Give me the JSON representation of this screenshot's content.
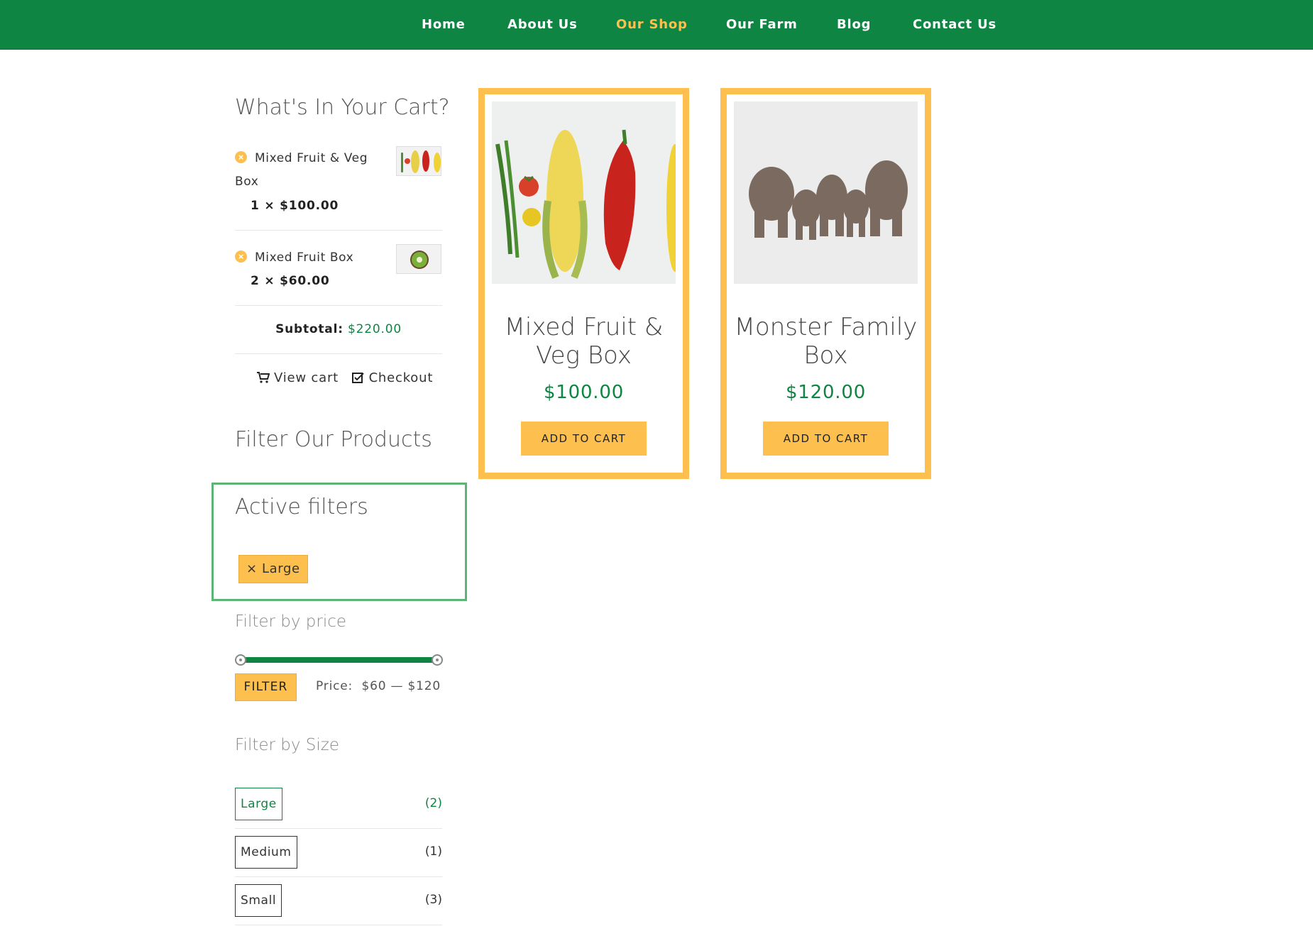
{
  "nav": {
    "items": [
      {
        "label": "Home",
        "active": false
      },
      {
        "label": "About Us",
        "active": false
      },
      {
        "label": "Our Shop",
        "active": true
      },
      {
        "label": "Our Farm",
        "active": false
      },
      {
        "label": "Blog",
        "active": false
      },
      {
        "label": "Contact Us",
        "active": false
      }
    ]
  },
  "cart": {
    "title": "What's In Your Cart?",
    "items": [
      {
        "name_line1": "Mixed Fruit & Veg",
        "name_line2": "Box",
        "qty": "1 × $100.00",
        "thumb_icon": "vegetables-thumbnail"
      },
      {
        "name_line1": "Mixed Fruit Box",
        "qty": "2 × $60.00",
        "thumb_icon": "kiwi-thumbnail"
      }
    ],
    "subtotal_label": "Subtotal:",
    "subtotal_value": "$220.00",
    "view_cart_label": "View cart",
    "checkout_label": "Checkout"
  },
  "filters": {
    "title": "Filter Our Products",
    "active_title": "Active filters",
    "active_chip": "× Large",
    "price_title": "Filter by price",
    "filter_button": "FILTER",
    "price_prefix": "Price:",
    "price_range": "$60 — $120",
    "size_title": "Filter by Size",
    "sizes": [
      {
        "label": "Large",
        "count": "(2)",
        "selected": true
      },
      {
        "label": "Medium",
        "count": "(1)",
        "selected": false
      },
      {
        "label": "Small",
        "count": "(3)",
        "selected": false
      }
    ]
  },
  "products": [
    {
      "title_line1": "Mixed Fruit &",
      "title_line2": "Veg Box",
      "price": "$100.00",
      "button": "ADD TO CART",
      "image_icon": "vegetables-photo"
    },
    {
      "title_line1": "Monster Family",
      "title_line2": "Box",
      "price": "$120.00",
      "button": "ADD TO CART",
      "image_icon": "elephants-photo"
    }
  ],
  "colors": {
    "brand_green": "#0e8542",
    "accent_yellow": "#fdc04f",
    "active_filter_border": "#5cb574"
  }
}
